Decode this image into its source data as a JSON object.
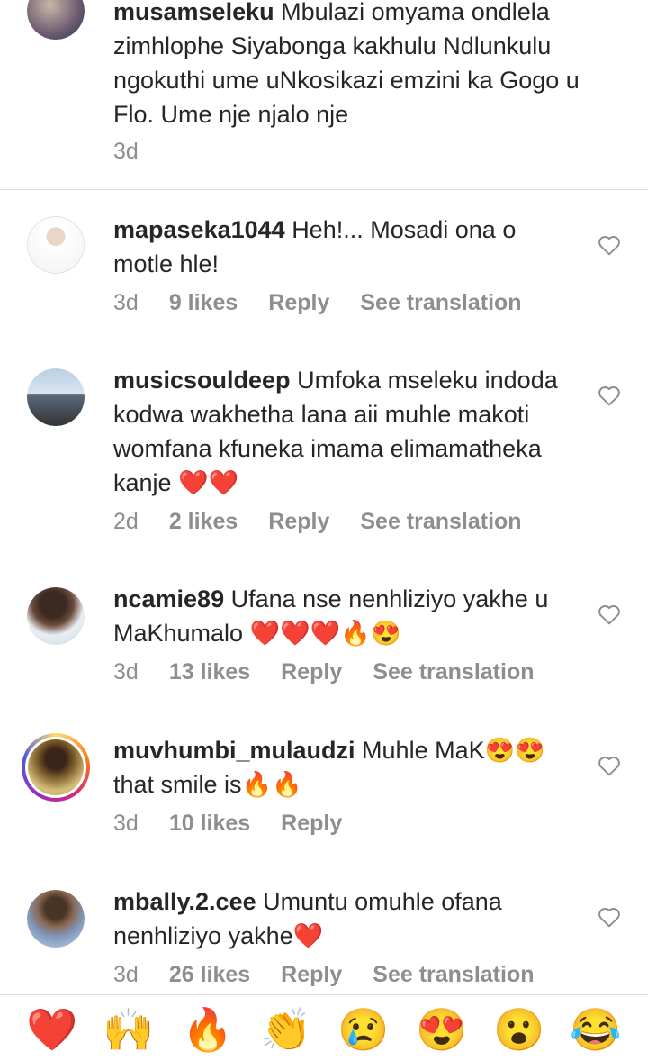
{
  "main_comment": {
    "username": "musamseleku",
    "text": "Mbulazi omyama ondlela zimhlophe Siyabonga kakhulu Ndlunkulu ngokuthi ume uNkosikazi emzini ka Gogo u Flo. Ume nje njalo nje",
    "time": "3d"
  },
  "comments": [
    {
      "username": "mapaseka1044",
      "text": "Heh!... Mosadi ona o motle hle!",
      "time": "3d",
      "likes": "9 likes",
      "reply": "Reply",
      "translate": "See translation"
    },
    {
      "username": "musicsouldeep",
      "text": "Umfoka mseleku indoda kodwa wakhetha lana aii muhle makoti womfana kfuneka imama elimamatheka kanje ❤️❤️",
      "time": "2d",
      "likes": "2 likes",
      "reply": "Reply",
      "translate": "See translation"
    },
    {
      "username": "ncamie89",
      "text": "Ufana nse nenhliziyo yakhe u MaKhumalo ❤️❤️❤️🔥😍",
      "time": "3d",
      "likes": "13 likes",
      "reply": "Reply",
      "translate": "See translation"
    },
    {
      "username": "muvhumbi_mulaudzi",
      "text": "Muhle MaK😍😍that smile is🔥🔥",
      "time": "3d",
      "likes": "10 likes",
      "reply": "Reply",
      "translate": ""
    },
    {
      "username": "mbally.2.cee",
      "text": "Umuntu omuhle ofana nenhliziyo yakhe❤️",
      "time": "3d",
      "likes": "26 likes",
      "reply": "Reply",
      "translate": "See translation"
    }
  ],
  "emoji_bar": [
    "❤️",
    "🙌",
    "🔥",
    "👏",
    "😢",
    "😍",
    "😮",
    "😂"
  ],
  "colors": {
    "secondary_text": "#8e8e8e",
    "divider": "#dbdbdb"
  }
}
